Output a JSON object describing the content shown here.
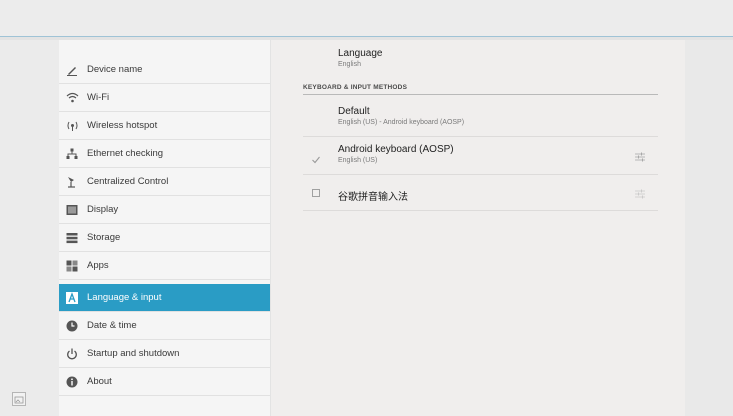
{
  "sidebar": {
    "items": [
      {
        "label": "Device name",
        "icon": "pencil-icon"
      },
      {
        "label": "Wi-Fi",
        "icon": "wifi-icon"
      },
      {
        "label": "Wireless hotspot",
        "icon": "hotspot-icon"
      },
      {
        "label": "Ethernet checking",
        "icon": "ethernet-icon"
      },
      {
        "label": "Centralized Control",
        "icon": "control-icon"
      },
      {
        "label": "Display",
        "icon": "display-icon"
      },
      {
        "label": "Storage",
        "icon": "storage-icon"
      },
      {
        "label": "Apps",
        "icon": "apps-icon"
      },
      {
        "label": "Language & input",
        "icon": "language-icon",
        "active": true
      },
      {
        "label": "Date & time",
        "icon": "clock-icon"
      },
      {
        "label": "Startup and shutdown",
        "icon": "power-icon"
      },
      {
        "label": "About",
        "icon": "info-icon"
      }
    ]
  },
  "content": {
    "language": {
      "title": "Language",
      "value": "English"
    },
    "section_header": "KEYBOARD & INPUT METHODS",
    "default": {
      "title": "Default",
      "value": "English (US) - Android keyboard (AOSP)"
    },
    "methods": [
      {
        "title": "Android keyboard (AOSP)",
        "sub": "English (US)",
        "checked": true
      },
      {
        "title": "谷歌拼音输入法",
        "sub": "",
        "checked": false
      }
    ]
  },
  "colors": {
    "accent": "#2a9cc5"
  }
}
